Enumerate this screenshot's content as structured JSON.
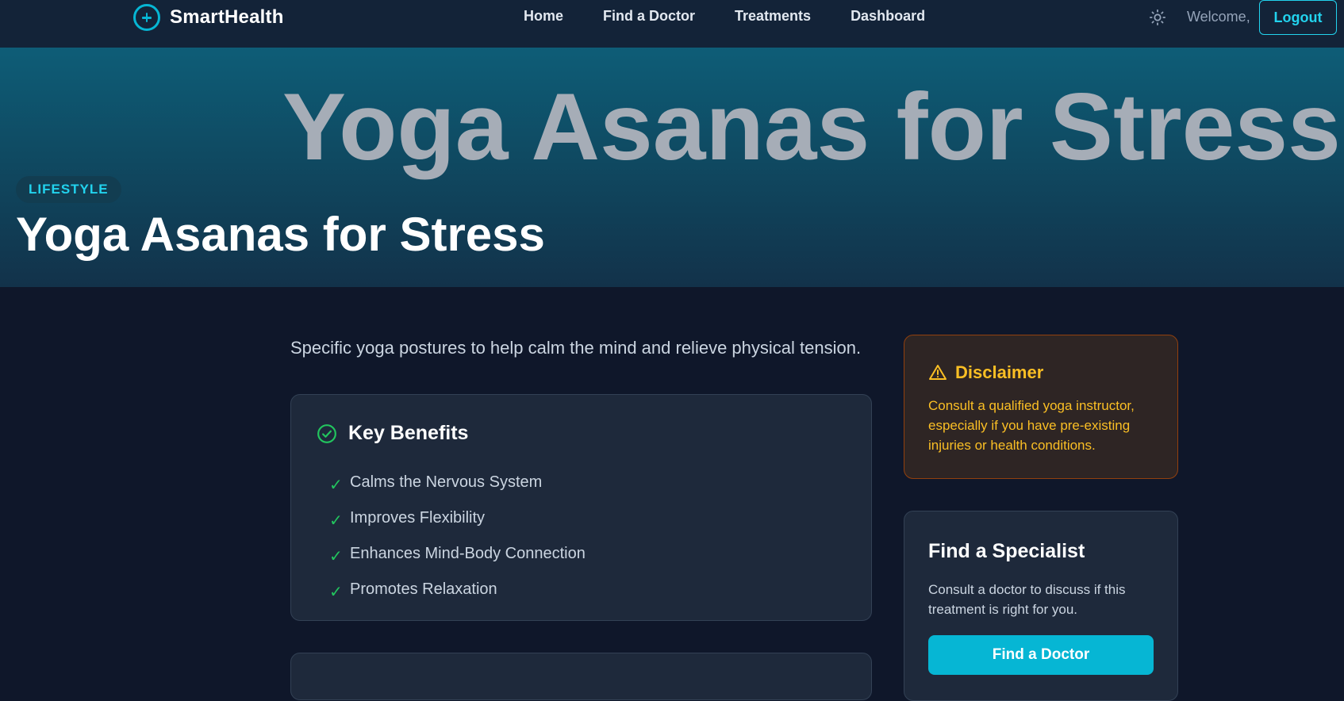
{
  "brand": {
    "name": "SmartHealth",
    "icon": "plus-circle-icon",
    "accent": "#06b6d4"
  },
  "nav": {
    "links": [
      "Home",
      "Find a Doctor",
      "Treatments",
      "Dashboard"
    ],
    "theme_icon": "sun-icon",
    "welcome": "Welcome,",
    "logout_label": "Logout"
  },
  "hero": {
    "watermark": "Yoga Asanas for Stress",
    "category": "LIFESTYLE",
    "title": "Yoga Asanas for Stress"
  },
  "main": {
    "lead": "Specific yoga postures to help calm the mind and relieve physical tension.",
    "benefits": {
      "title": "Key Benefits",
      "icon": "check-circle-icon",
      "items": [
        "Calms the Nervous System",
        "Improves Flexibility",
        "Enhances Mind-Body Connection",
        "Promotes Relaxation"
      ]
    }
  },
  "sidebar": {
    "disclaimer": {
      "icon": "warning-triangle-icon",
      "title": "Disclaimer",
      "text": "Consult a qualified yoga instructor, especially if you have pre-existing injuries or health conditions."
    },
    "specialist": {
      "title": "Find a Specialist",
      "text": "Consult a doctor to discuss if this treatment is right for you.",
      "button_label": "Find a Doctor"
    }
  },
  "colors": {
    "background": "#0f172a",
    "card": "#1e293b",
    "accent": "#06b6d4",
    "warning": "#fbbf24",
    "success": "#22c55e"
  }
}
